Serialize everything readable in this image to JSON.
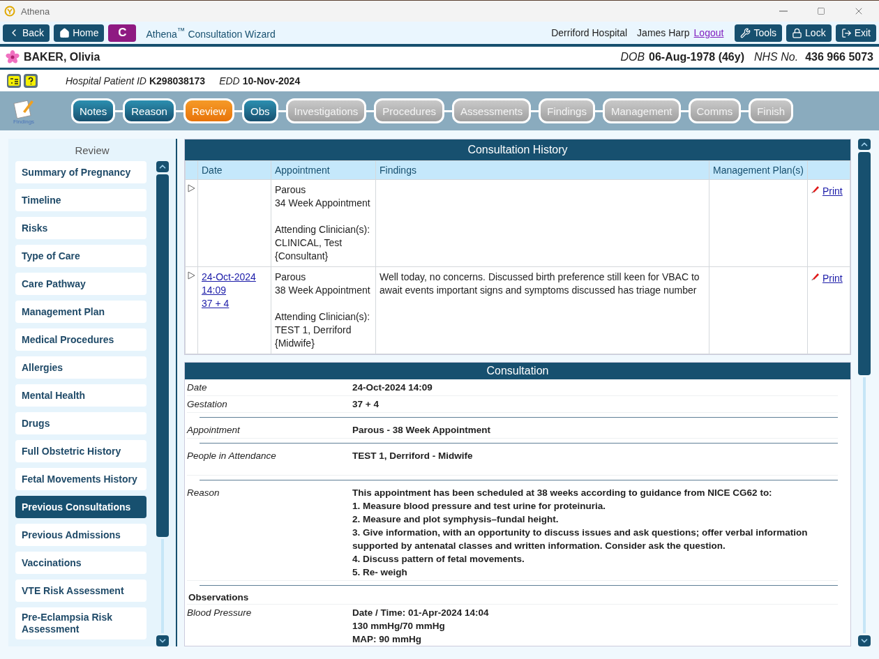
{
  "window": {
    "title": "Athena"
  },
  "toolbar": {
    "back": "Back",
    "home": "Home",
    "c_button": "C",
    "app_title": "Athena$^{™}$ Consultation Wizard",
    "hospital": "Derriford Hospital",
    "user": "James Harp",
    "logout": "Logout",
    "buttons": [
      {
        "kind": "tools",
        "label": "Tools"
      },
      {
        "kind": "lock",
        "label": "Lock"
      },
      {
        "kind": "exit",
        "label": "Exit"
      }
    ]
  },
  "patient": {
    "name": "BAKER, Olivia",
    "dob_label": "DOB",
    "dob": "06-Aug-1978 (46y)",
    "nhs_label": "NHS No.",
    "nhs": "436 966 5073"
  },
  "info": {
    "hospital_id_label": "Hospital Patient ID",
    "hospital_id": "K298038173",
    "edd_label": "EDD",
    "edd": "10-Nov-2024"
  },
  "wizard": {
    "icon_label": "Findings",
    "steps": [
      {
        "label": "Notes",
        "selected": false,
        "completed": true
      },
      {
        "label": "Reason",
        "selected": false,
        "completed": true
      },
      {
        "label": "Review",
        "selected": true,
        "completed": false
      },
      {
        "label": "Obs",
        "selected": false,
        "completed": true
      },
      {
        "label": "Investigations",
        "selected": false,
        "completed": false
      },
      {
        "label": "Procedures",
        "selected": false,
        "completed": false
      },
      {
        "label": "Assessments",
        "selected": false,
        "completed": false
      },
      {
        "label": "Findings",
        "selected": false,
        "completed": false
      },
      {
        "label": "Management",
        "selected": false,
        "completed": false
      },
      {
        "label": "Comms",
        "selected": false,
        "completed": false
      },
      {
        "label": "Finish",
        "selected": false,
        "completed": false
      }
    ]
  },
  "sidebar": {
    "title": "Review",
    "items": [
      {
        "label": "Summary of Pregnancy",
        "selected": false
      },
      {
        "label": "Timeline",
        "selected": false
      },
      {
        "label": "Risks",
        "selected": false
      },
      {
        "label": "Type of Care",
        "selected": false
      },
      {
        "label": "Care Pathway",
        "selected": false
      },
      {
        "label": "Management Plan",
        "selected": false
      },
      {
        "label": "Medical Procedures",
        "selected": false
      },
      {
        "label": "Allergies",
        "selected": false
      },
      {
        "label": "Mental Health",
        "selected": false
      },
      {
        "label": "Drugs",
        "selected": false
      },
      {
        "label": "Full Obstetric History",
        "selected": false
      },
      {
        "label": "Fetal Movements History",
        "selected": false
      },
      {
        "label": "Previous Consultations",
        "selected": true
      },
      {
        "label": "Previous Admissions",
        "selected": false
      },
      {
        "label": "Vaccinations",
        "selected": false
      },
      {
        "label": "VTE Risk Assessment",
        "selected": false
      },
      {
        "label": "Pre-Eclampsia Risk Assessment",
        "selected": false
      }
    ]
  },
  "history": {
    "title": "Consultation History",
    "columns": [
      "Date",
      "Appointment",
      "Findings",
      "Management Plan(s)"
    ],
    "rows": [
      {
        "date": [],
        "appointment": [
          "Parous",
          "34 Week Appointment"
        ],
        "clinicians": [
          "Attending Clinician(s):",
          "CLINICAL, Test",
          "{Consultant}"
        ],
        "findings": "",
        "print": "Print"
      },
      {
        "date": [
          "24-Oct-2024",
          "14:09",
          "37 + 4"
        ],
        "appointment": [
          "Parous",
          "38 Week Appointment"
        ],
        "clinicians": [
          "Attending Clinician(s):",
          "TEST 1, Derriford",
          "{Midwife}"
        ],
        "findings": "Well today, no concerns.  Discussed birth preference still keen for VBAC to await events important signs and symptoms discussed has triage number",
        "print": "Print"
      }
    ]
  },
  "consultation": {
    "title": "Consultation",
    "fields": [
      {
        "kind": "field",
        "label": "Date",
        "lines": [
          "24-Oct-2024 14:09"
        ]
      },
      {
        "kind": "field",
        "label": "Gestation",
        "lines": [
          "37 + 4"
        ]
      },
      {
        "kind": "divider"
      },
      {
        "kind": "field",
        "label": "Appointment",
        "lines": [
          "Parous - 38 Week Appointment"
        ]
      },
      {
        "kind": "divider"
      },
      {
        "kind": "field",
        "label": "People in Attendance",
        "lines": [
          "TEST 1, Derriford - Midwife"
        ],
        "tall": true
      },
      {
        "kind": "divider"
      },
      {
        "kind": "field",
        "label": "Reason",
        "lines": [
          "This appointment has been scheduled at 38 weeks according to guidance from NICE CG62 to:",
          "1. Measure blood pressure and test urine for proteinuria.",
          "2. Measure and plot symphysis–fundal height.",
          "3. Give information, with an opportunity to discuss issues and ask questions; offer verbal information supported by antenatal classes and written information. Consider ask the question.",
          "4. Discuss pattern of fetal movements.",
          "5. Re- weigh"
        ]
      },
      {
        "kind": "divider"
      },
      {
        "kind": "heading",
        "label": "Observations"
      },
      {
        "kind": "field",
        "label": "Blood Pressure",
        "lines": [
          "Date / Time: 01-Apr-2024 14:04",
          "130 mmHg/70 mmHg",
          "MAP: 90 mmHg"
        ]
      }
    ]
  }
}
